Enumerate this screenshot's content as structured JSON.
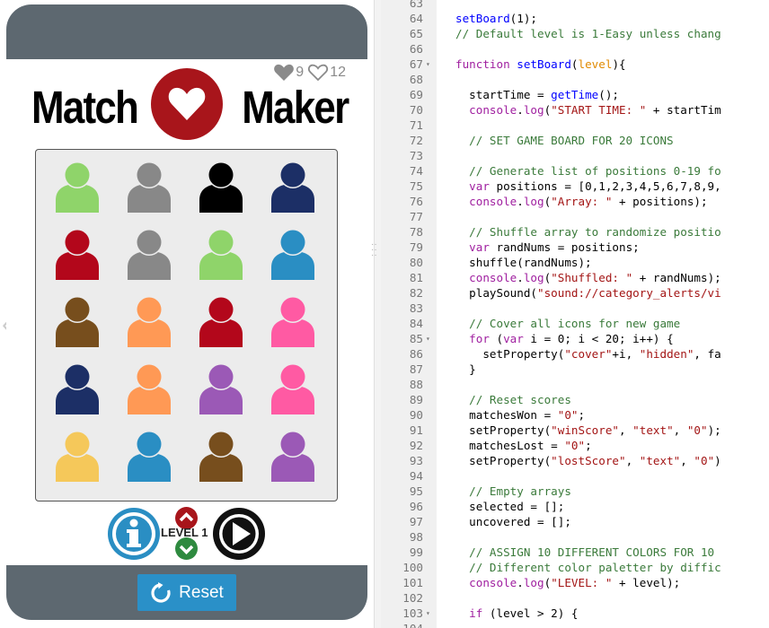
{
  "app": {
    "scores": {
      "won": "9",
      "lost": "12"
    },
    "logo": {
      "left_word": "Match",
      "right_word": "Maker"
    },
    "board": {
      "rows": [
        [
          "#8fd46a",
          "#888888",
          "#000000",
          "#1c2f66"
        ],
        [
          "#b3071b",
          "#888888",
          "#8fd46a",
          "#2a8ec3"
        ],
        [
          "#774e1d",
          "#ff9955",
          "#b3071b",
          "#ff5aa3"
        ],
        [
          "#1c2f66",
          "#ff9955",
          "#9b59b6",
          "#ff5aa3"
        ],
        [
          "#f5c85a",
          "#2a8ec3",
          "#774e1d",
          "#9b59b6"
        ]
      ]
    },
    "controls": {
      "level_label": "LEVEL 1"
    },
    "reset_label": "Reset"
  },
  "editor": {
    "lines": [
      {
        "n": "63",
        "fold": false,
        "code": []
      },
      {
        "n": "64",
        "fold": false,
        "code": [
          [
            "fn",
            "setBoard"
          ],
          [
            "blk",
            "(1);"
          ]
        ]
      },
      {
        "n": "65",
        "fold": false,
        "code": [
          [
            "cm",
            "// Default level is 1-Easy unless chang"
          ]
        ]
      },
      {
        "n": "66",
        "fold": false,
        "code": []
      },
      {
        "n": "67",
        "fold": true,
        "code": [
          [
            "kw",
            "function "
          ],
          [
            "fn",
            "setBoard"
          ],
          [
            "blk",
            "("
          ],
          [
            "prm",
            "level"
          ],
          [
            "blk",
            "){"
          ]
        ]
      },
      {
        "n": "68",
        "fold": false,
        "code": []
      },
      {
        "n": "69",
        "fold": false,
        "code": [
          [
            "blk",
            "  startTime = "
          ],
          [
            "fn",
            "getTime"
          ],
          [
            "blk",
            "();"
          ]
        ]
      },
      {
        "n": "70",
        "fold": false,
        "code": [
          [
            "blk",
            "  "
          ],
          [
            "kw",
            "console"
          ],
          [
            "blk",
            "."
          ],
          [
            "kw",
            "log"
          ],
          [
            "blk",
            "("
          ],
          [
            "str",
            "\"START TIME: \""
          ],
          [
            "blk",
            " + startTim"
          ]
        ]
      },
      {
        "n": "71",
        "fold": false,
        "code": []
      },
      {
        "n": "72",
        "fold": false,
        "code": [
          [
            "blk",
            "  "
          ],
          [
            "cm",
            "// SET GAME BOARD FOR 20 ICONS"
          ]
        ]
      },
      {
        "n": "73",
        "fold": false,
        "code": []
      },
      {
        "n": "74",
        "fold": false,
        "code": [
          [
            "blk",
            "  "
          ],
          [
            "cm",
            "// Generate list of positions 0-19 fo"
          ]
        ]
      },
      {
        "n": "75",
        "fold": false,
        "code": [
          [
            "blk",
            "  "
          ],
          [
            "kw",
            "var"
          ],
          [
            "blk",
            " positions = [0,1,2,3,4,5,6,7,8,9,"
          ]
        ]
      },
      {
        "n": "76",
        "fold": false,
        "code": [
          [
            "blk",
            "  "
          ],
          [
            "kw",
            "console"
          ],
          [
            "blk",
            "."
          ],
          [
            "kw",
            "log"
          ],
          [
            "blk",
            "("
          ],
          [
            "str",
            "\"Array: \""
          ],
          [
            "blk",
            " + positions);"
          ]
        ]
      },
      {
        "n": "77",
        "fold": false,
        "code": []
      },
      {
        "n": "78",
        "fold": false,
        "code": [
          [
            "blk",
            "  "
          ],
          [
            "cm",
            "// Shuffle array to randomize positio"
          ]
        ]
      },
      {
        "n": "79",
        "fold": false,
        "code": [
          [
            "blk",
            "  "
          ],
          [
            "kw",
            "var"
          ],
          [
            "blk",
            " randNums = positions;"
          ]
        ]
      },
      {
        "n": "80",
        "fold": false,
        "code": [
          [
            "blk",
            "  shuffle(randNums);"
          ]
        ]
      },
      {
        "n": "81",
        "fold": false,
        "code": [
          [
            "blk",
            "  "
          ],
          [
            "kw",
            "console"
          ],
          [
            "blk",
            "."
          ],
          [
            "kw",
            "log"
          ],
          [
            "blk",
            "("
          ],
          [
            "str",
            "\"Shuffled: \""
          ],
          [
            "blk",
            " + randNums);"
          ]
        ]
      },
      {
        "n": "82",
        "fold": false,
        "code": [
          [
            "blk",
            "  playSound("
          ],
          [
            "str",
            "\"sound://category_alerts/vi"
          ]
        ]
      },
      {
        "n": "83",
        "fold": false,
        "code": []
      },
      {
        "n": "84",
        "fold": false,
        "code": [
          [
            "blk",
            "  "
          ],
          [
            "cm",
            "// Cover all icons for new game"
          ]
        ]
      },
      {
        "n": "85",
        "fold": true,
        "code": [
          [
            "blk",
            "  "
          ],
          [
            "kw",
            "for"
          ],
          [
            "blk",
            " ("
          ],
          [
            "kw",
            "var"
          ],
          [
            "blk",
            " i = 0; i < 20; i++) {"
          ]
        ]
      },
      {
        "n": "86",
        "fold": false,
        "code": [
          [
            "blk",
            "    setProperty("
          ],
          [
            "str",
            "\"cover\""
          ],
          [
            "blk",
            "+i, "
          ],
          [
            "str",
            "\"hidden\""
          ],
          [
            "blk",
            ", fa"
          ]
        ]
      },
      {
        "n": "87",
        "fold": false,
        "code": [
          [
            "blk",
            "  }"
          ]
        ]
      },
      {
        "n": "88",
        "fold": false,
        "code": []
      },
      {
        "n": "89",
        "fold": false,
        "code": [
          [
            "blk",
            "  "
          ],
          [
            "cm",
            "// Reset scores"
          ]
        ]
      },
      {
        "n": "90",
        "fold": false,
        "code": [
          [
            "blk",
            "  matchesWon = "
          ],
          [
            "str",
            "\"0\""
          ],
          [
            "blk",
            ";"
          ]
        ]
      },
      {
        "n": "91",
        "fold": false,
        "code": [
          [
            "blk",
            "  setProperty("
          ],
          [
            "str",
            "\"winScore\""
          ],
          [
            "blk",
            ", "
          ],
          [
            "str",
            "\"text\""
          ],
          [
            "blk",
            ", "
          ],
          [
            "str",
            "\"0\""
          ],
          [
            "blk",
            ");"
          ]
        ]
      },
      {
        "n": "92",
        "fold": false,
        "code": [
          [
            "blk",
            "  matchesLost = "
          ],
          [
            "str",
            "\"0\""
          ],
          [
            "blk",
            ";"
          ]
        ]
      },
      {
        "n": "93",
        "fold": false,
        "code": [
          [
            "blk",
            "  setProperty("
          ],
          [
            "str",
            "\"lostScore\""
          ],
          [
            "blk",
            ", "
          ],
          [
            "str",
            "\"text\""
          ],
          [
            "blk",
            ", "
          ],
          [
            "str",
            "\"0\""
          ],
          [
            "blk",
            ")"
          ]
        ]
      },
      {
        "n": "94",
        "fold": false,
        "code": []
      },
      {
        "n": "95",
        "fold": false,
        "code": [
          [
            "blk",
            "  "
          ],
          [
            "cm",
            "// Empty arrays"
          ]
        ]
      },
      {
        "n": "96",
        "fold": false,
        "code": [
          [
            "blk",
            "  selected = [];"
          ]
        ]
      },
      {
        "n": "97",
        "fold": false,
        "code": [
          [
            "blk",
            "  uncovered = [];"
          ]
        ]
      },
      {
        "n": "98",
        "fold": false,
        "code": []
      },
      {
        "n": "99",
        "fold": false,
        "code": [
          [
            "blk",
            "  "
          ],
          [
            "cm",
            "// ASSIGN 10 DIFFERENT COLORS FOR 10 "
          ]
        ]
      },
      {
        "n": "100",
        "fold": false,
        "code": [
          [
            "blk",
            "  "
          ],
          [
            "cm",
            "// Different color paletter by diffic"
          ]
        ]
      },
      {
        "n": "101",
        "fold": false,
        "code": [
          [
            "blk",
            "  "
          ],
          [
            "kw",
            "console"
          ],
          [
            "blk",
            "."
          ],
          [
            "kw",
            "log"
          ],
          [
            "blk",
            "("
          ],
          [
            "str",
            "\"LEVEL: \""
          ],
          [
            "blk",
            " + level);"
          ]
        ]
      },
      {
        "n": "102",
        "fold": false,
        "code": []
      },
      {
        "n": "103",
        "fold": true,
        "code": [
          [
            "blk",
            "  "
          ],
          [
            "kw",
            "if"
          ],
          [
            "blk",
            " (level > 2) {"
          ]
        ]
      },
      {
        "n": "104",
        "fold": false,
        "code": []
      }
    ]
  }
}
